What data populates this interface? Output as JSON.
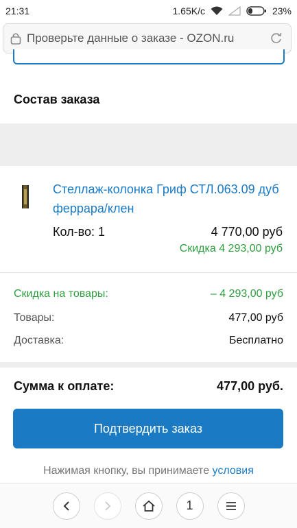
{
  "status_bar": {
    "time": "21:31",
    "speed": "1.65K/c",
    "battery": "23%"
  },
  "address_bar": {
    "title": "Проверьте данные о заказе - OZON.ru"
  },
  "order": {
    "section_title": "Состав заказа"
  },
  "product": {
    "name": "Стеллаж-колонка Гриф СТЛ.063.09 дуб феррара/клен",
    "qty_label": "Кол-во: 1",
    "price": "4 770,00 руб",
    "discount": "Скидка 4 293,00 руб"
  },
  "totals": {
    "discount_label": "Скидка на товары:",
    "discount_value": "– 4 293,00 руб",
    "goods_label": "Товары:",
    "goods_value": "477,00 руб",
    "delivery_label": "Доставка:",
    "delivery_value": "Бесплатно",
    "sum_label": "Сумма к оплате:",
    "sum_value": "477,00 руб."
  },
  "confirm_button": "Подтвердить заказ",
  "terms": {
    "text": "Нажимая кнопку, вы принимаете ",
    "link": "условия"
  },
  "bottom_nav": {
    "tab_count": "1"
  },
  "colors": {
    "accent": "#1a7bc4",
    "discount_green": "#2e9e3e"
  }
}
